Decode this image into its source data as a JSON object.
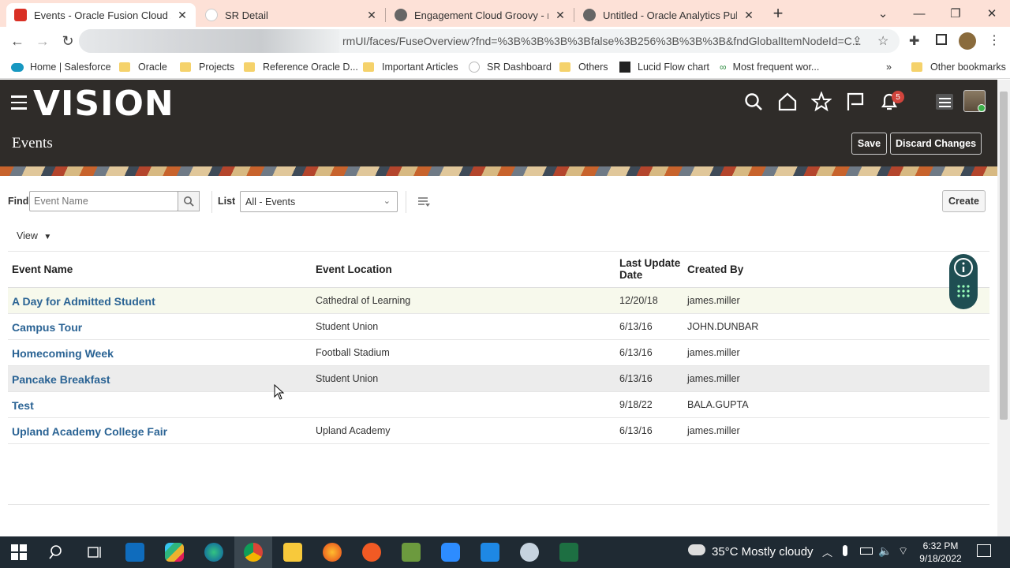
{
  "browser": {
    "tabs": [
      {
        "title": "Events - Oracle Fusion Cloud App",
        "color": "#d93025",
        "active": true
      },
      {
        "title": "SR Detail",
        "color": "#e8e8e8",
        "active": false
      },
      {
        "title": "Engagement Cloud Groovy - repl",
        "color": "#555555",
        "active": false
      },
      {
        "title": "Untitled - Oracle Analytics Publis",
        "color": "#555555",
        "active": false
      }
    ],
    "url": "rmUI/faces/FuseOverview?fnd=%3B%3B%3B%3Bfalse%3B256%3B%3B%3B&fndGlobalItemNodeId=C...",
    "bookmarks": [
      {
        "label": "Home | Salesforce",
        "icon": "salesforce-icon"
      },
      {
        "label": "Oracle",
        "icon": "folder-icon"
      },
      {
        "label": "Projects",
        "icon": "folder-icon"
      },
      {
        "label": "Reference Oracle D...",
        "icon": "folder-icon"
      },
      {
        "label": "Important Articles",
        "icon": "folder-icon"
      },
      {
        "label": "SR Dashboard",
        "icon": "page-icon"
      },
      {
        "label": "Others",
        "icon": "folder-icon"
      },
      {
        "label": "Lucid Flow chart",
        "icon": "lucid-icon"
      },
      {
        "label": "Most frequent wor...",
        "icon": "link-icon"
      }
    ],
    "more_bookmarks": "»",
    "other_bookmarks": "Other bookmarks"
  },
  "app": {
    "logo": "VISION",
    "page_title": "Events",
    "save_label": "Save",
    "discard_label": "Discard Changes",
    "notification_count": "5"
  },
  "search": {
    "find_label": "Find",
    "find_placeholder": "Event Name",
    "list_label": "List",
    "list_value": "All - Events",
    "create_label": "Create",
    "view_label": "View"
  },
  "table": {
    "headers": {
      "name": "Event Name",
      "location": "Event Location",
      "date_line1": "Last Update",
      "date_line2": "Date",
      "created_by": "Created By"
    },
    "rows": [
      {
        "name": "A Day for Admitted Student",
        "location": "Cathedral of Learning",
        "date": "12/20/18",
        "created_by": "james.miller"
      },
      {
        "name": "Campus Tour",
        "location": "Student Union",
        "date": "6/13/16",
        "created_by": "JOHN.DUNBAR"
      },
      {
        "name": "Homecoming Week",
        "location": "Football Stadium",
        "date": "6/13/16",
        "created_by": "james.miller"
      },
      {
        "name": "Pancake Breakfast",
        "location": "Student Union",
        "date": "6/13/16",
        "created_by": "james.miller"
      },
      {
        "name": "Test",
        "location": "",
        "date": "9/18/22",
        "created_by": "BALA.GUPTA"
      },
      {
        "name": "Upland Academy College Fair",
        "location": "Upland Academy",
        "date": "6/13/16",
        "created_by": "james.miller"
      }
    ]
  },
  "taskbar": {
    "weather": "35°C  Mostly cloudy",
    "time": "6:32 PM",
    "date": "9/18/2022"
  },
  "colors": {
    "header_bg": "#2f2c29",
    "link": "#2a6394",
    "tab_strip": "#fde1d7"
  }
}
